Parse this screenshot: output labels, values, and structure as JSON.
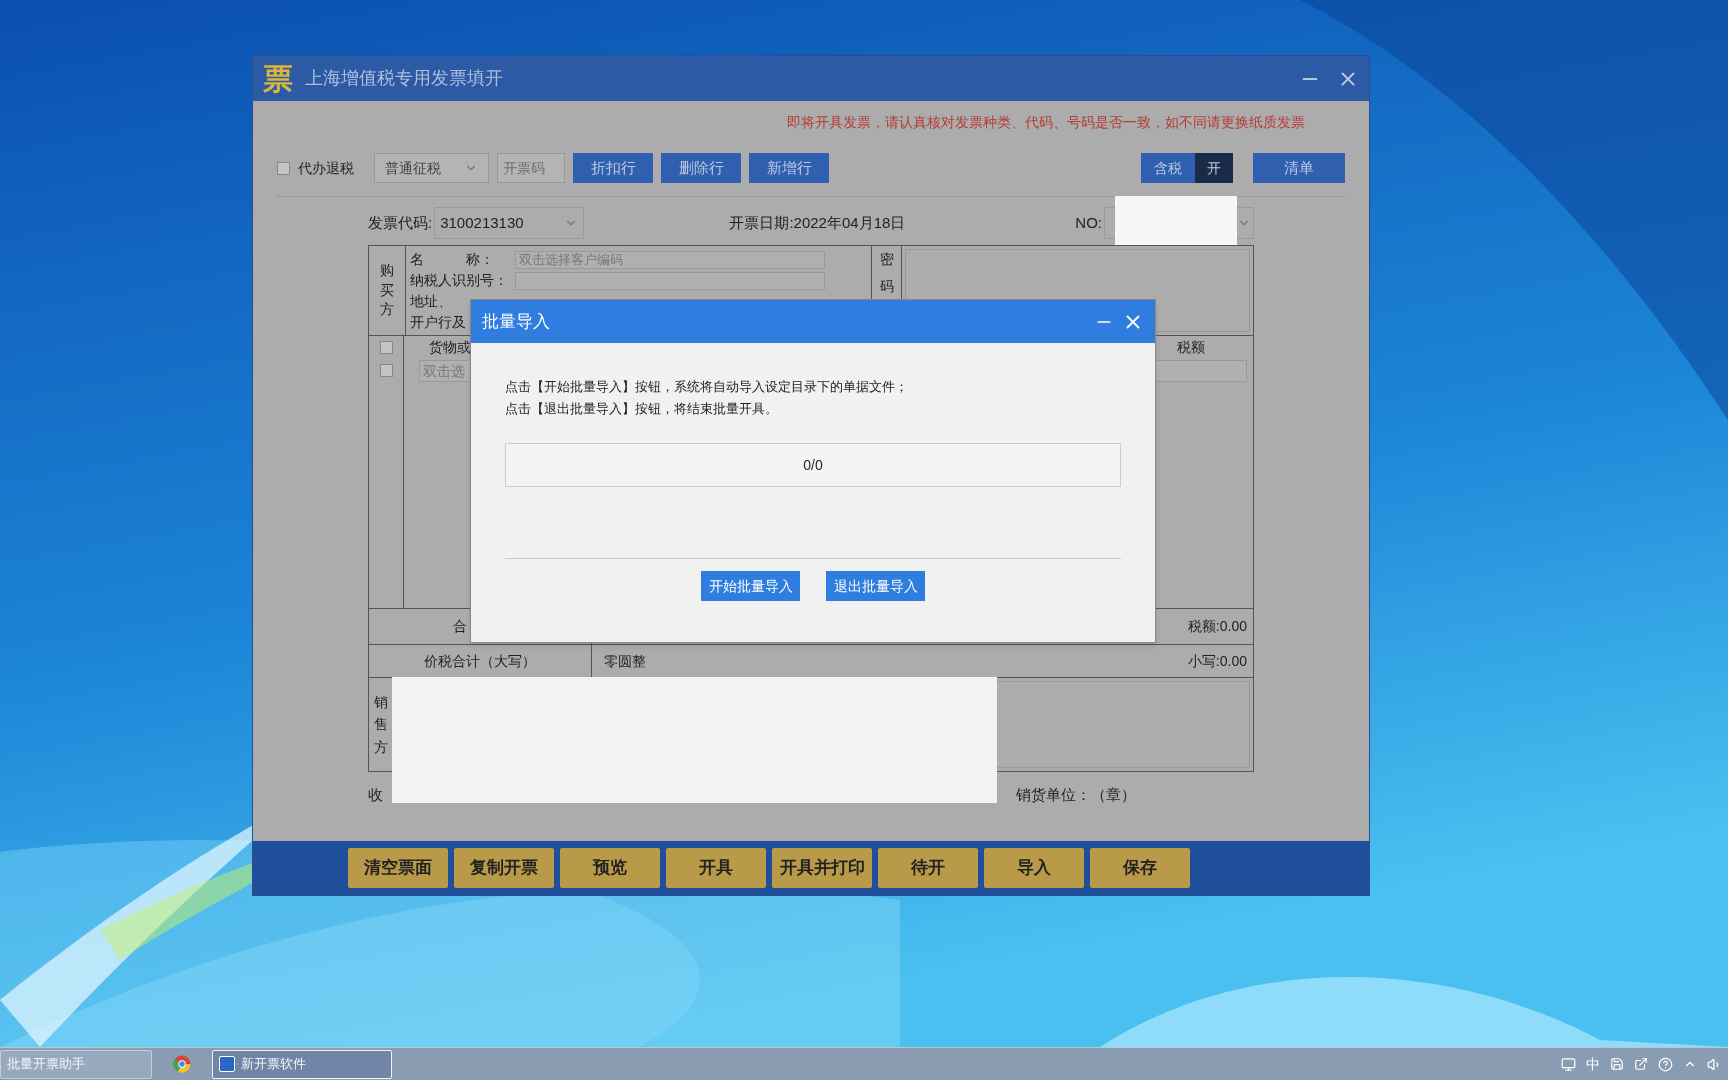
{
  "window": {
    "logo": "票",
    "title": "上海增值税专用发票填开",
    "notice": "即将开具发票，请认真核对发票种类、代码、号码是否一致，如不同请更换纸质发票"
  },
  "toolbar": {
    "agent_refund": {
      "label": "代办退税",
      "checked": false
    },
    "tax_mode": {
      "value": "普通征税"
    },
    "code_field": {
      "placeholder": "开票码"
    },
    "buttons": [
      "折扣行",
      "删除行",
      "新增行"
    ],
    "tax_toggle": {
      "label": "含税",
      "state_label": "开",
      "on": true
    },
    "list_button": "清单"
  },
  "invoice": {
    "code_label": "发票代码:",
    "code": "3100213130",
    "date": "开票日期:2022年04月18日",
    "no_label": "NO:"
  },
  "buyer": {
    "side_label": "购买方",
    "fields": [
      {
        "label": "名　　　称：",
        "placeholder": "双击选择客户编码"
      },
      {
        "label": "纳税人识别号："
      },
      {
        "label": "地址、"
      },
      {
        "label": "开户行及"
      }
    ],
    "cipher_label": "密码"
  },
  "goods": {
    "header_checkbox": {
      "checked": false
    },
    "columns": [
      "货物或",
      "税额"
    ],
    "rows": [
      {
        "checked": false,
        "placeholder": "双击选"
      }
    ]
  },
  "totals": {
    "label": "合",
    "tax": "税额:0.00"
  },
  "grand_total": {
    "label": "价税合计（大写）",
    "words": "零圆整",
    "figures": "小写:0.00"
  },
  "seller": {
    "side_label": "销售方"
  },
  "footer": {
    "payee": "收",
    "seal": "销货单位：（章）"
  },
  "actions": [
    "清空票面",
    "复制开票",
    "预览",
    "开具",
    "开具并打印",
    "待开",
    "导入",
    "保存"
  ],
  "dialog": {
    "title": "批量导入",
    "lines": [
      "点击【开始批量导入】按钮，系统将自动导入设定目录下的单据文件；",
      "点击【退出批量导入】按钮，将结束批量开具。"
    ],
    "progress": {
      "text": "0/0",
      "level": 0
    },
    "buttons": [
      "开始批量导入",
      "退出批量导入"
    ]
  },
  "taskbar": {
    "items": [
      {
        "kind": "button",
        "label": "批量开票助手",
        "selected": false
      },
      {
        "kind": "icon",
        "selected": false
      },
      {
        "kind": "button",
        "label": "新开票软件",
        "selected": true
      }
    ],
    "ime": "中"
  }
}
